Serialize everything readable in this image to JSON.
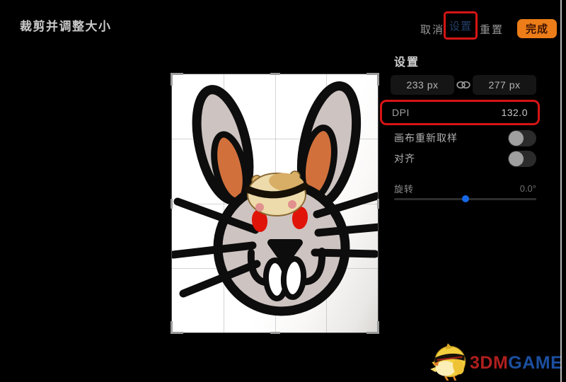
{
  "title": "裁剪并调整大小",
  "toolbar": {
    "cancel": "取消",
    "settings": "设置",
    "reset": "重置",
    "done": "完成"
  },
  "panel": {
    "header": "设置",
    "width_value": "233 px",
    "height_value": "277 px",
    "dpi_label": "DPI",
    "dpi_value": "132.0",
    "resample_label": "画布重新取样",
    "resample_on": false,
    "snap_label": "对齐",
    "snap_on": false,
    "rotation_label": "旋转",
    "rotation_value": "0.0°",
    "rotation_slider_percent": 48
  },
  "annotation": {
    "highlight_color": "#d61414",
    "highlighted_items": [
      "settings-button",
      "dpi-field"
    ]
  },
  "colors": {
    "done_button": "#ec7d18",
    "slider_dot": "#1668e8",
    "canvas_bg": "#ffffff"
  },
  "watermark": {
    "brand_red": "3DM",
    "brand_blue": "GAME"
  }
}
